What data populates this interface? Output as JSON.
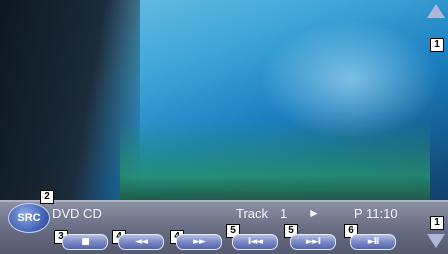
{
  "source_button": {
    "label": "SRC"
  },
  "status": {
    "source_name": "DVD CD",
    "track_label": "Track",
    "track_number": "1",
    "play_state_glyph": "►",
    "preset_time": "P 11:10"
  },
  "controls": [
    {
      "icon": "stop-icon",
      "glyph": "■"
    },
    {
      "icon": "rewind-icon",
      "glyph": "◄◄"
    },
    {
      "icon": "fast-forward-icon",
      "glyph": "►►"
    },
    {
      "icon": "previous-track-icon",
      "glyph": "I◄◄"
    },
    {
      "icon": "next-track-icon",
      "glyph": "►►I"
    },
    {
      "icon": "play-pause-icon",
      "glyph": "►II"
    }
  ],
  "callouts": {
    "scroll_up": "1",
    "source": "2",
    "stop": "3",
    "rewind": "4",
    "fast_forward": "4",
    "previous_track": "5",
    "next_track": "5",
    "play_pause": "6",
    "scroll_down": "1"
  },
  "scroll": {
    "up_icon": "arrow-up-icon",
    "down_icon": "arrow-down-icon"
  },
  "colors": {
    "panel": "#6b6f86",
    "button": "#7a88c4",
    "src_button": "#405fb0",
    "text": "#f5f6fb"
  }
}
